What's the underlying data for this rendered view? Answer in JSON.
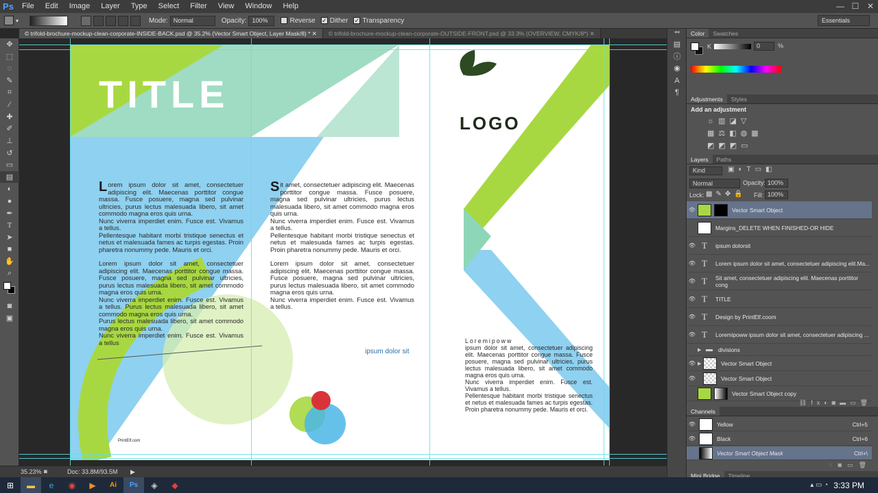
{
  "app": {
    "logo": "Ps"
  },
  "menu": [
    "File",
    "Edit",
    "Image",
    "Layer",
    "Type",
    "Select",
    "Filter",
    "View",
    "Window",
    "Help"
  ],
  "window_controls": [
    "—",
    "☐",
    "✕"
  ],
  "options": {
    "mode_label": "Mode:",
    "mode_value": "Normal",
    "opacity_label": "Opacity:",
    "opacity_value": "100%",
    "reverse": "Reverse",
    "dither": "Dither",
    "transparency": "Transparency",
    "workspace": "Essentials"
  },
  "tabs": [
    "© trifold-brochure-mockup-clean-corporate-INSIDE-BACK.psd @ 35.2% (Vector Smart Object, Layer Mask/8) * ✕",
    "© trifold-brochure-mockup-clean-corporate-OUTSIDE-FRONT.psd @ 33.3% (OVERVIEW, CMYK/8*) ✕"
  ],
  "document": {
    "title": "TITLE",
    "logo_text": "LOGO",
    "credit": "PrintElf.com",
    "col1_dropcap": "L",
    "col1_p1": "orem ipsum dolor sit amet, consectetuer adipiscing elit. Maecenas porttitor congue massa. Fusce posuere, magna sed pulvinar ultricies, purus lectus malesuada libero, sit amet commodo magna eros quis urna.",
    "col1_p2": "Nunc viverra imperdiet enim. Fusce est. Vivamus a tellus.",
    "col1_p3": "Pellentesque habitant morbi tristique senectus et netus et malesuada fames ac turpis egestas. Proin pharetra nonummy pede. Mauris et orci.",
    "col1_p4": "Lorem ipsum dolor sit amet, consectetuer adipiscing elit. Maecenas porttitor congue massa. Fusce posuere, magna sed pulvinar ultricies, purus lectus malesuada libero, sit amet commodo magna eros quis urna.",
    "col1_p5": "Nunc viverra imperdiet enim. Fusce est. Vivamus a tellus. Purus lectus malesuada libero, sit amet commodo magna eros quis urna.",
    "col1_p6": "Purus lectus malesuada libero, sit amet commodo magna eros quis urna.",
    "col1_p7": "Nunc viverra imperdiet enim. Fusce est. Vivamus a tellus",
    "col2_dropcap": "S",
    "col2_p1": "it amet, consectetuer adipiscing elit. Maecenas porttitor congue massa. Fusce posuere, magna sed pulvinar ultricies, purus lectus malesuada libero, sit amet commodo magna eros quis urna.",
    "col2_p2": "Nunc viverra imperdiet enim. Fusce est. Vivamus a tellus.",
    "col2_p3": "Pellentesque habitant morbi tristique senectus et netus et malesuada fames ac turpis egestas. Proin pharetra nonummy pede. Mauris et orci.",
    "col2_p4": "Lorem ipsum dolor sit amet, consectetuer adipiscing elit. Maecenas porttitor congue massa. Fusce posuere, magna sed pulvinar ultricies, purus lectus malesuada libero, sit amet commodo magna eros quis urna.",
    "col2_p5": "Nunc viverra imperdiet enim. Fusce est. Vivamus a tellus.",
    "col2_tagline": "ipsum dolor sit",
    "col3_heading": "Loremipoww",
    "col3_p1": "ipsum dolor sit amet, consectetuer adipiscing elit. Maecenas porttitor congue massa. Fusce posuere, magna sed pulvinar ultricies, purus lectus malesuada libero, sit amet commodo magna eros quis urna.",
    "col3_p2": "Nunc viverra imperdiet enim. Fusce est. Vivamus a tellus.",
    "col3_p3": "Pellentesque habitant morbi tristique senectus et netus et malesuada fames ac turpis egestas. Proin pharetra nonummy pede. Mauris et orci."
  },
  "status": {
    "zoom": "35.23%",
    "doc_size": "Doc: 33.8M/93.5M"
  },
  "colors": {
    "green": "#a8d841",
    "blue": "#8fd1f0",
    "teal": "#8ed6b8",
    "logo": "#2d4a22",
    "text": "#2a2a2a",
    "selection": "#65738b",
    "accent_text": "#2a6fa8"
  },
  "color_panel": {
    "tabs": [
      "Color",
      "Swatches"
    ],
    "channel": "K",
    "value": "0",
    "unit": "%"
  },
  "adjustments_panel": {
    "tabs": [
      "Adjustments",
      "Styles"
    ],
    "hint": "Add an adjustment"
  },
  "layers_panel": {
    "tabs": [
      "Layers",
      "Paths"
    ],
    "kind": "Kind",
    "blend": "Normal",
    "opacity_label": "Opacity:",
    "opacity": "100%",
    "lock_label": "Lock:",
    "fill_label": "Fill:",
    "fill": "100%",
    "layers": [
      {
        "name": "Vector Smart Object",
        "type": "smart",
        "selected": true
      },
      {
        "name": "Margins_DELETE WHEN FINISHED-OR HIDE",
        "type": "pixel",
        "selected": false
      },
      {
        "name": "ipsum dolorsit",
        "type": "text",
        "selected": false
      },
      {
        "name": "Lorem ipsum dolor sit amet, consectetuer adipiscing elit.Ma...",
        "type": "text",
        "selected": false
      },
      {
        "name": "Sit amet, consectetuer adipiscing elit. Maecenas porttitor cong",
        "type": "text",
        "selected": false
      },
      {
        "name": "TITLE",
        "type": "text",
        "selected": false
      },
      {
        "name": "Design by PrintElf.coom",
        "type": "text",
        "selected": false
      },
      {
        "name": "Loremipoww ipsum dolor sit amet, consectetuer adipiscing ...",
        "type": "text",
        "selected": false
      },
      {
        "name": "divisions",
        "type": "group",
        "selected": false
      },
      {
        "name": "Vector Smart Object",
        "type": "smart",
        "selected": false
      },
      {
        "name": "Vector Smart Object",
        "type": "smart",
        "selected": false
      },
      {
        "name": "Vector Smart Object copy",
        "type": "smart",
        "selected": false
      }
    ]
  },
  "channels_panel": {
    "tab": "Channels",
    "channels": [
      {
        "name": "Yellow",
        "shortcut": "Ctrl+5"
      },
      {
        "name": "Black",
        "shortcut": "Ctrl+6"
      },
      {
        "name": "Vector Smart Object Mask",
        "shortcut": "Ctrl+\\"
      }
    ]
  },
  "bottom_tabs": [
    "Mini Bridge",
    "Timeline"
  ],
  "taskbar": {
    "time": "3:33 PM"
  }
}
